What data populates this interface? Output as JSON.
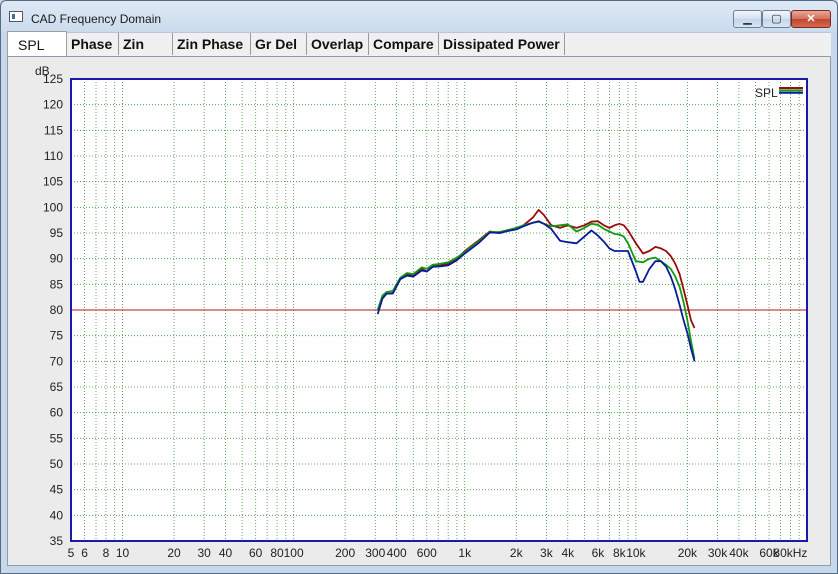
{
  "window": {
    "title": "CAD Frequency Domain",
    "min_glyph": "▁",
    "max_glyph": "▢",
    "close_glyph": "✕"
  },
  "tabs": [
    {
      "label": "SPL",
      "active": true
    },
    {
      "label": "Phase"
    },
    {
      "label": "Zin"
    },
    {
      "label": "Zin Phase"
    },
    {
      "label": "Gr Del"
    },
    {
      "label": "Overlap"
    },
    {
      "label": "Compare"
    },
    {
      "label": "Dissipated Power"
    }
  ],
  "colors": {
    "red": "#9b0b0b",
    "green": "#119b11",
    "blue": "#0a1a9b",
    "grid": "#3f8f3f",
    "refline": "#b81414",
    "frame": "#1a1aa8"
  },
  "chart_data": {
    "type": "line",
    "yunit": "dB",
    "xunit": "Hz",
    "xscale": "log",
    "xlim": [
      5,
      100000
    ],
    "ylim": [
      35,
      125
    ],
    "yticks": [
      35,
      40,
      45,
      50,
      55,
      60,
      65,
      70,
      75,
      80,
      85,
      90,
      95,
      100,
      105,
      110,
      115,
      120,
      125
    ],
    "xtick_labels": [
      {
        "v": 5,
        "t": "5"
      },
      {
        "v": 6,
        "t": "6"
      },
      {
        "v": 8,
        "t": "8"
      },
      {
        "v": 10,
        "t": "10"
      },
      {
        "v": 20,
        "t": "20"
      },
      {
        "v": 30,
        "t": "30"
      },
      {
        "v": 40,
        "t": "40"
      },
      {
        "v": 60,
        "t": "60"
      },
      {
        "v": 80,
        "t": "80"
      },
      {
        "v": 100,
        "t": "100"
      },
      {
        "v": 200,
        "t": "200"
      },
      {
        "v": 300,
        "t": "300"
      },
      {
        "v": 400,
        "t": "400"
      },
      {
        "v": 600,
        "t": "600"
      },
      {
        "v": 1000,
        "t": "1k"
      },
      {
        "v": 2000,
        "t": "2k"
      },
      {
        "v": 3000,
        "t": "3k"
      },
      {
        "v": 4000,
        "t": "4k"
      },
      {
        "v": 6000,
        "t": "6k"
      },
      {
        "v": 8000,
        "t": "8k"
      },
      {
        "v": 10000,
        "t": "10k"
      },
      {
        "v": 20000,
        "t": "20k"
      },
      {
        "v": 30000,
        "t": "30k"
      },
      {
        "v": 40000,
        "t": "40k"
      },
      {
        "v": 60000,
        "t": "60k"
      },
      {
        "v": 80000,
        "t": "80kHz"
      }
    ],
    "reference_line": 80,
    "legend": {
      "label": "SPL",
      "position": "top-right"
    },
    "grid": true,
    "series": [
      {
        "color": "red",
        "points": [
          [
            310,
            80
          ],
          [
            330,
            82.5
          ],
          [
            350,
            83.5
          ],
          [
            380,
            83.6
          ],
          [
            420,
            86
          ],
          [
            460,
            87
          ],
          [
            500,
            86.8
          ],
          [
            560,
            88
          ],
          [
            600,
            87.5
          ],
          [
            650,
            88.5
          ],
          [
            720,
            88.8
          ],
          [
            800,
            89
          ],
          [
            900,
            90
          ],
          [
            1000,
            91.5
          ],
          [
            1200,
            93.5
          ],
          [
            1400,
            95.3
          ],
          [
            1600,
            95
          ],
          [
            1800,
            95.5
          ],
          [
            2000,
            95.8
          ],
          [
            2200,
            96.5
          ],
          [
            2500,
            98
          ],
          [
            2700,
            99.5
          ],
          [
            2900,
            98.5
          ],
          [
            3200,
            96.5
          ],
          [
            3600,
            96
          ],
          [
            4000,
            96.5
          ],
          [
            4500,
            96
          ],
          [
            5000,
            96.5
          ],
          [
            5500,
            97.2
          ],
          [
            6000,
            97.3
          ],
          [
            6500,
            96.5
          ],
          [
            7000,
            96
          ],
          [
            7500,
            96.5
          ],
          [
            8000,
            96.8
          ],
          [
            8500,
            96.5
          ],
          [
            9000,
            95.5
          ],
          [
            10000,
            93
          ],
          [
            11000,
            91
          ],
          [
            12000,
            91.5
          ],
          [
            13000,
            92.3
          ],
          [
            14000,
            92
          ],
          [
            15000,
            91.5
          ],
          [
            16000,
            90.5
          ],
          [
            17000,
            89
          ],
          [
            18000,
            87
          ],
          [
            19000,
            84
          ],
          [
            20000,
            81
          ],
          [
            21000,
            78
          ],
          [
            22000,
            76.5
          ]
        ]
      },
      {
        "color": "green",
        "points": [
          [
            310,
            80
          ],
          [
            330,
            82.8
          ],
          [
            350,
            83.5
          ],
          [
            380,
            83.7
          ],
          [
            420,
            86.3
          ],
          [
            460,
            87.2
          ],
          [
            500,
            87
          ],
          [
            560,
            88.3
          ],
          [
            600,
            88
          ],
          [
            650,
            88.8
          ],
          [
            720,
            89
          ],
          [
            800,
            89.3
          ],
          [
            900,
            90.2
          ],
          [
            1000,
            91.3
          ],
          [
            1200,
            93.3
          ],
          [
            1400,
            95.2
          ],
          [
            1600,
            95.2
          ],
          [
            1800,
            95.6
          ],
          [
            2000,
            96
          ],
          [
            2200,
            96.5
          ],
          [
            2500,
            97
          ],
          [
            2700,
            97.2
          ],
          [
            2900,
            96.8
          ],
          [
            3200,
            96.3
          ],
          [
            3600,
            96.5
          ],
          [
            4000,
            96.7
          ],
          [
            4500,
            95.3
          ],
          [
            5000,
            96
          ],
          [
            5500,
            96.8
          ],
          [
            6000,
            96.6
          ],
          [
            6500,
            95.8
          ],
          [
            7000,
            95.3
          ],
          [
            7500,
            94.8
          ],
          [
            8000,
            94.7
          ],
          [
            8500,
            94.3
          ],
          [
            9000,
            93
          ],
          [
            10000,
            89.5
          ],
          [
            11000,
            89.3
          ],
          [
            12000,
            90
          ],
          [
            13000,
            90.2
          ],
          [
            14000,
            89.5
          ],
          [
            15000,
            88.8
          ],
          [
            16000,
            88
          ],
          [
            17000,
            86.5
          ],
          [
            18000,
            84.5
          ],
          [
            19000,
            81.5
          ],
          [
            20000,
            78
          ],
          [
            21000,
            74
          ],
          [
            22000,
            70.5
          ]
        ]
      },
      {
        "color": "blue",
        "points": [
          [
            310,
            79.2
          ],
          [
            330,
            82.2
          ],
          [
            350,
            83.2
          ],
          [
            380,
            83.2
          ],
          [
            420,
            86
          ],
          [
            460,
            86.7
          ],
          [
            500,
            86.5
          ],
          [
            560,
            87.7
          ],
          [
            600,
            87.5
          ],
          [
            650,
            88.4
          ],
          [
            720,
            88.5
          ],
          [
            800,
            88.7
          ],
          [
            900,
            89.7
          ],
          [
            1000,
            91
          ],
          [
            1200,
            93
          ],
          [
            1400,
            95.1
          ],
          [
            1600,
            95
          ],
          [
            1800,
            95.4
          ],
          [
            2000,
            95.7
          ],
          [
            2200,
            96.3
          ],
          [
            2500,
            97
          ],
          [
            2700,
            97.3
          ],
          [
            2900,
            96.8
          ],
          [
            3200,
            95.8
          ],
          [
            3600,
            93.5
          ],
          [
            4000,
            93.2
          ],
          [
            4500,
            93
          ],
          [
            5000,
            94.3
          ],
          [
            5500,
            95.5
          ],
          [
            6000,
            94.5
          ],
          [
            6500,
            93.3
          ],
          [
            7000,
            92
          ],
          [
            7500,
            91.5
          ],
          [
            8000,
            91.5
          ],
          [
            8500,
            91.5
          ],
          [
            9000,
            91.5
          ],
          [
            10000,
            87.5
          ],
          [
            10500,
            85.5
          ],
          [
            11000,
            85.5
          ],
          [
            12000,
            88
          ],
          [
            13000,
            89.5
          ],
          [
            14000,
            89.5
          ],
          [
            15000,
            88.5
          ],
          [
            16000,
            86.5
          ],
          [
            17000,
            84
          ],
          [
            18000,
            81
          ],
          [
            19000,
            78
          ],
          [
            20000,
            75.5
          ],
          [
            21000,
            72.5
          ],
          [
            22000,
            70
          ]
        ]
      }
    ]
  }
}
